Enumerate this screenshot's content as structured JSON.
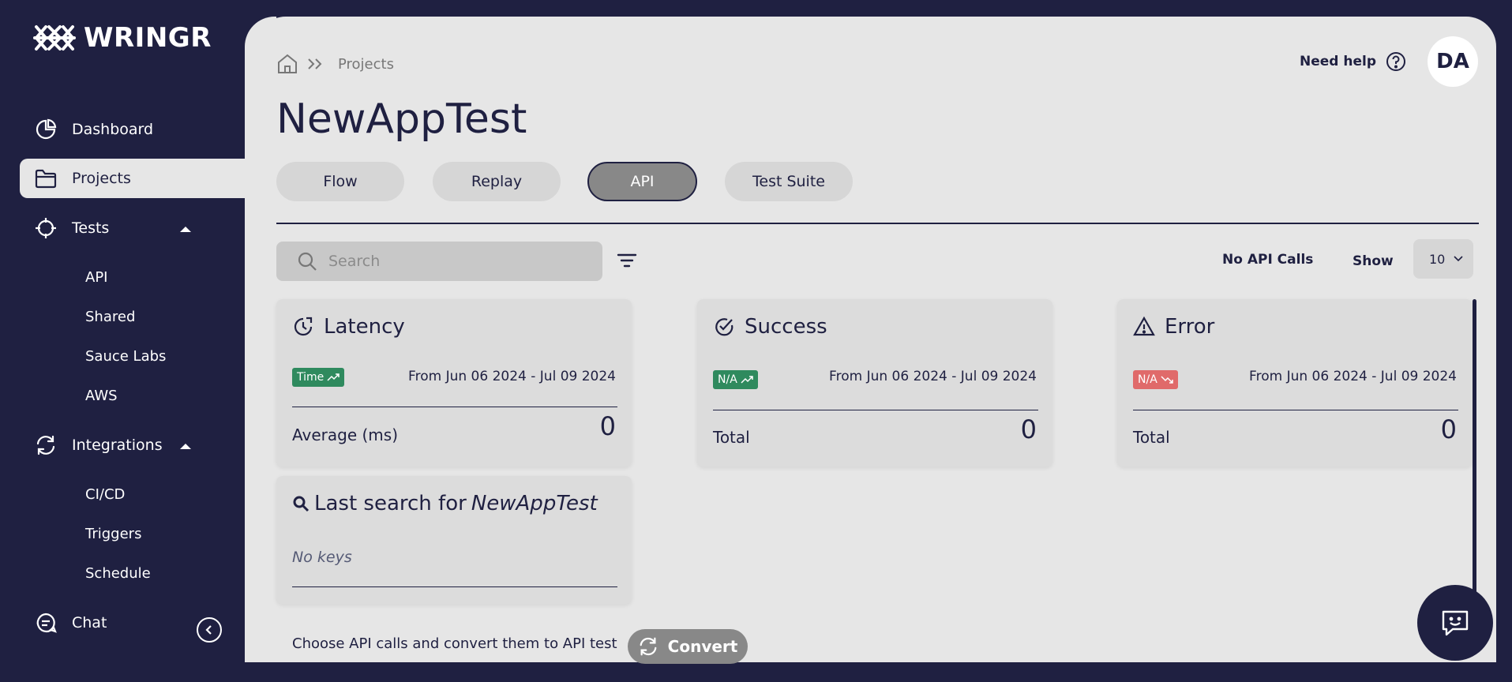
{
  "brand": {
    "name": "WRINGR"
  },
  "sidebar": {
    "items": [
      {
        "label": "Dashboard",
        "icon": "pie-chart-icon"
      },
      {
        "label": "Projects",
        "icon": "folder-icon",
        "active": true
      },
      {
        "label": "Tests",
        "icon": "target-icon",
        "expanded": true,
        "children": [
          "API",
          "Shared",
          "Sauce Labs",
          "AWS"
        ]
      },
      {
        "label": "Integrations",
        "icon": "sync-icon",
        "expanded": true,
        "children": [
          "CI/CD",
          "Triggers",
          "Schedule"
        ]
      },
      {
        "label": "Chat",
        "icon": "chat-icon"
      }
    ]
  },
  "header": {
    "breadcrumb": "Projects",
    "help_label": "Need help",
    "avatar_initials": "DA",
    "title": "NewAppTest"
  },
  "tabs": [
    {
      "label": "Flow"
    },
    {
      "label": "Replay"
    },
    {
      "label": "API",
      "active": true
    },
    {
      "label": "Test Suite"
    }
  ],
  "toolbar": {
    "search_placeholder": "Search",
    "api_calls_status": "No API Calls",
    "show_label": "Show",
    "show_value": "10"
  },
  "cards": {
    "latency": {
      "title": "Latency",
      "badge": "Time",
      "date_range": "From Jun 06 2024 - Jul 09 2024",
      "metric_label": "Average (ms)",
      "value": "0"
    },
    "success": {
      "title": "Success",
      "badge": "N/A",
      "date_range": "From Jun 06 2024 - Jul 09 2024",
      "metric_label": "Total",
      "value": "0"
    },
    "error": {
      "title": "Error",
      "badge": "N/A",
      "date_range": "From Jun 06 2024 - Jul 09 2024",
      "metric_label": "Total",
      "value": "0"
    }
  },
  "last_search": {
    "prefix": "Last search for",
    "project": "NewAppTest",
    "empty_text": "No keys"
  },
  "footer": {
    "hint": "Choose API calls and convert them to API test",
    "convert_label": "Convert"
  },
  "colors": {
    "navy": "#1f2041",
    "panel": "#e6e6e6",
    "card": "#dcdcdc",
    "badge_green": "#2f8a5e",
    "badge_red": "#e06a6a",
    "tab_active": "#888888"
  }
}
